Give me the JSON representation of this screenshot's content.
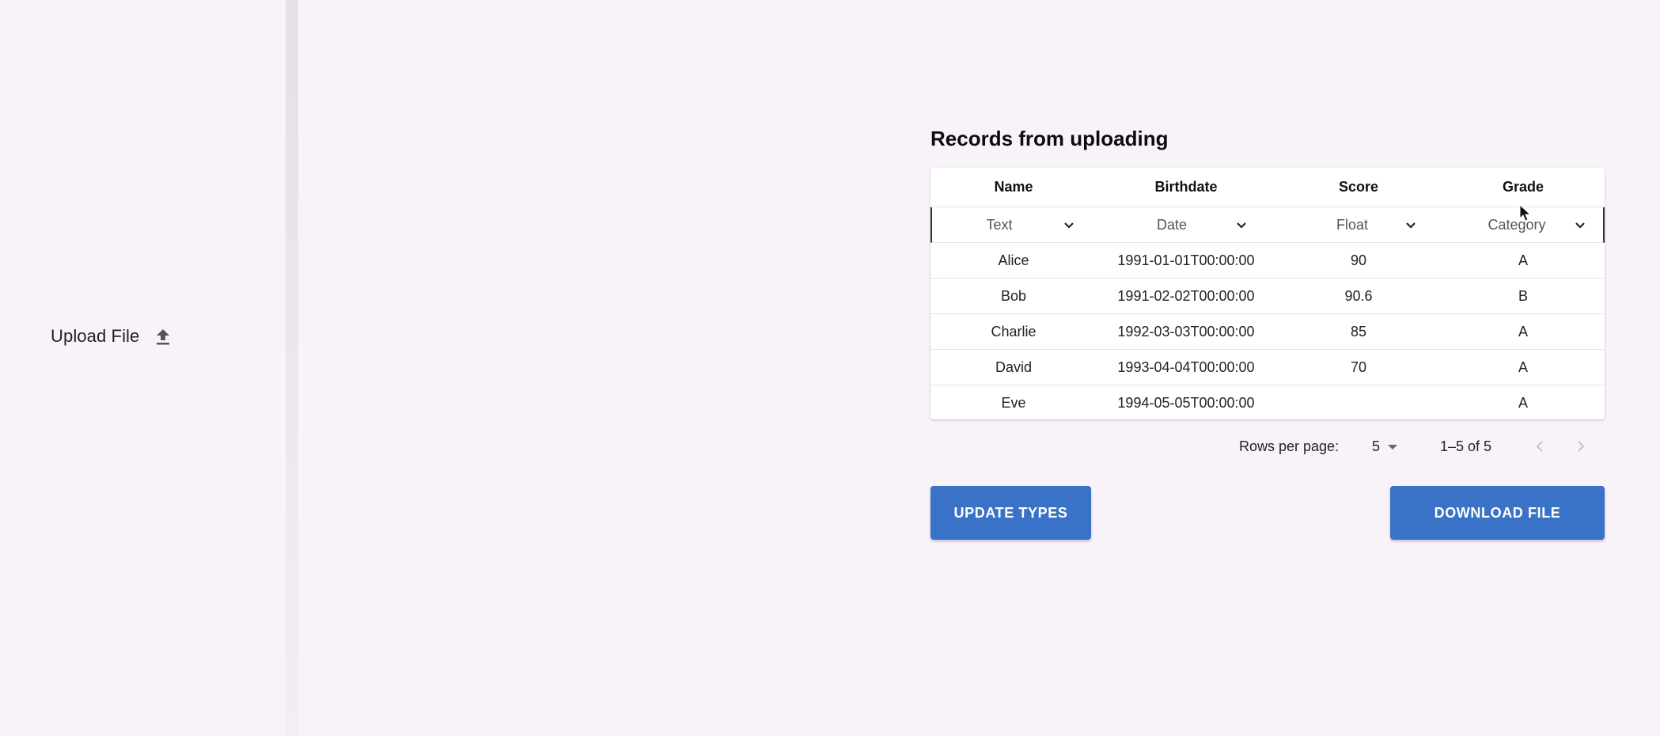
{
  "sidebar": {
    "upload_label": "Upload File",
    "upload_icon": "upload-icon"
  },
  "main": {
    "title": "Records from uploading",
    "columns": [
      {
        "header": "Name",
        "type": "Text"
      },
      {
        "header": "Birthdate",
        "type": "Date"
      },
      {
        "header": "Score",
        "type": "Float"
      },
      {
        "header": "Grade",
        "type": "Category"
      }
    ],
    "rows": [
      [
        "Alice",
        "1991-01-01T00:00:00",
        "90",
        "A"
      ],
      [
        "Bob",
        "1991-02-02T00:00:00",
        "90.6",
        "B"
      ],
      [
        "Charlie",
        "1992-03-03T00:00:00",
        "85",
        "A"
      ],
      [
        "David",
        "1993-04-04T00:00:00",
        "70",
        "A"
      ],
      [
        "Eve",
        "1994-05-05T00:00:00",
        "",
        "A"
      ]
    ],
    "pagination": {
      "rows_per_page_label": "Rows per page:",
      "rows_per_page_value": "5",
      "range": "1–5 of 5"
    },
    "buttons": {
      "update_types": "UPDATE TYPES",
      "download_file": "DOWNLOAD FILE"
    }
  },
  "colors": {
    "background": "#f8f3f9",
    "primary_button": "#3a72c8"
  }
}
